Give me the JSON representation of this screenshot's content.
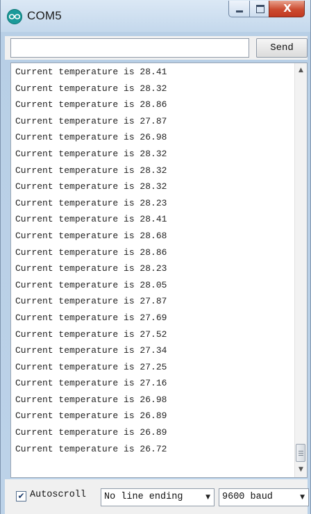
{
  "window": {
    "title": "COM5",
    "close_glyph": "X"
  },
  "send_bar": {
    "input_value": "",
    "send_label": "Send"
  },
  "serial_output": {
    "lines": [
      "Current temperature is 28.41",
      "Current temperature is 28.32",
      "Current temperature is 28.86",
      "Current temperature is 27.87",
      "Current temperature is 26.98",
      "Current temperature is 28.32",
      "Current temperature is 28.32",
      "Current temperature is 28.32",
      "Current temperature is 28.23",
      "Current temperature is 28.41",
      "Current temperature is 28.68",
      "Current temperature is 28.86",
      "Current temperature is 28.23",
      "Current temperature is 28.05",
      "Current temperature is 27.87",
      "Current temperature is 27.69",
      "Current temperature is 27.52",
      "Current temperature is 27.34",
      "Current temperature is 27.25",
      "Current temperature is 27.16",
      "Current temperature is 26.98",
      "Current temperature is 26.89",
      "Current temperature is 26.89",
      "Current temperature is 26.72"
    ]
  },
  "footer": {
    "autoscroll_checked": true,
    "autoscroll_label": "Autoscroll",
    "line_ending": "No line ending",
    "baud_rate": "9600 baud"
  },
  "icons": {
    "app": "arduino-icon",
    "minimize": "minimize-icon",
    "maximize": "maximize-icon",
    "close": "close-icon",
    "scroll_up": "scroll-up-arrow-icon",
    "scroll_down": "scroll-down-arrow-icon",
    "dropdown": "chevron-down-icon",
    "checkbox": "check-icon"
  },
  "colors": {
    "title_bar": "#c4d8ec",
    "close_button": "#cc4b30",
    "app_icon": "#1b9a9a"
  }
}
